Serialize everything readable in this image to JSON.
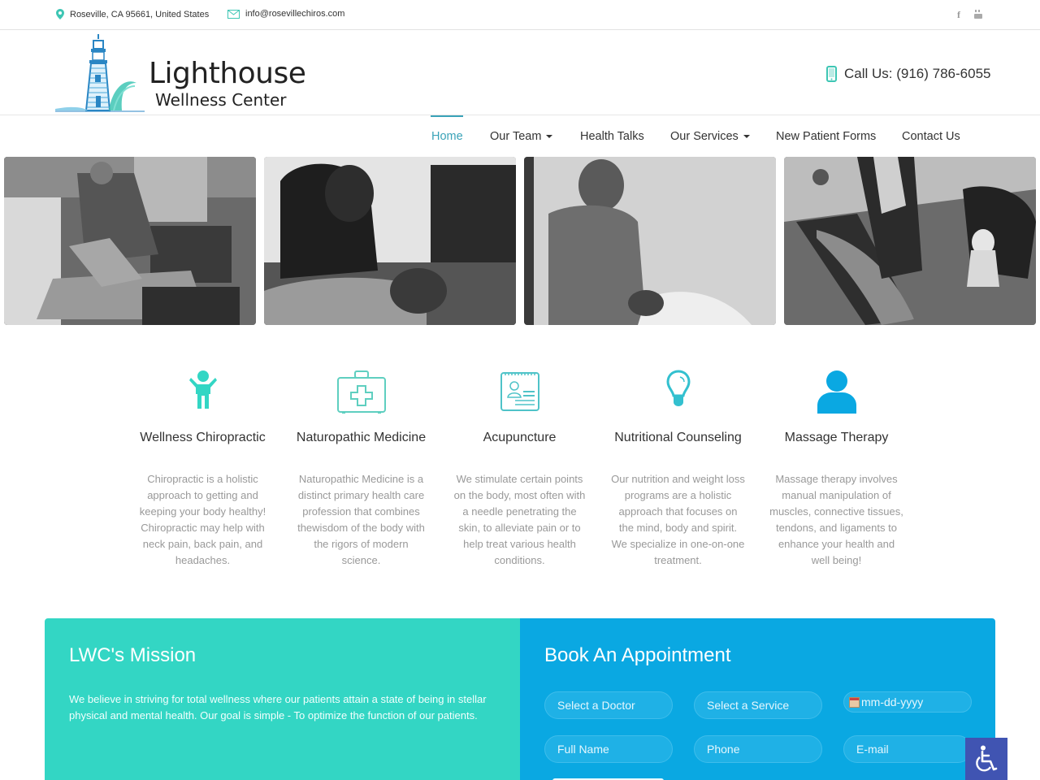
{
  "topbar": {
    "address": "Roseville, CA 95661, United States",
    "email": "info@rosevillechiros.com",
    "social": [
      {
        "name": "facebook",
        "glyph": "f"
      },
      {
        "name": "youtube",
        "glyph": "▣"
      }
    ]
  },
  "header": {
    "logo_title": "Lighthouse",
    "logo_subtitle": "Wellness Center",
    "call_label": "Call Us: (916) 786-6055"
  },
  "nav": {
    "items": [
      {
        "label": "Home",
        "active": true,
        "dropdown": false
      },
      {
        "label": "Our Team",
        "active": false,
        "dropdown": true
      },
      {
        "label": "Health Talks",
        "active": false,
        "dropdown": false
      },
      {
        "label": "Our Services",
        "active": false,
        "dropdown": true
      },
      {
        "label": "New Patient Forms",
        "active": false,
        "dropdown": false
      },
      {
        "label": "Contact Us",
        "active": false,
        "dropdown": false
      }
    ]
  },
  "photos": [
    {
      "alt": "Chiropractor adjusting patient's leg"
    },
    {
      "alt": "Practitioner pressing on patient's back"
    },
    {
      "alt": "Chiropractor adjusting patient's neck"
    },
    {
      "alt": "Practitioner adjusting patient while children watch"
    }
  ],
  "services": [
    {
      "icon": "child-icon",
      "title": "Wellness Chiropractic",
      "description": "Chiropractic is a holistic approach to getting and keeping your body healthy! Chiropractic may help with neck pain, back pain, and headaches."
    },
    {
      "icon": "medical-kit-icon",
      "title": "Naturopathic Medicine",
      "description": "Naturopathic Medicine is a distinct primary health care profession that combines thewisdom of the body with the rigors of modern science."
    },
    {
      "icon": "patient-chart-icon",
      "title": "Acupuncture",
      "description": "We stimulate certain points on the body, most often with a needle penetrating the skin, to alleviate pain or to help treat various health conditions."
    },
    {
      "icon": "lightbulb-icon",
      "title": "Nutritional Counseling",
      "description": "Our nutrition and weight loss programs are a holistic approach that focuses on the mind, body and spirit. We specialize in one-on-one treatment."
    },
    {
      "icon": "person-icon",
      "title": "Massage Therapy",
      "description": "Massage therapy involves manual manipulation of muscles, connective tissues, tendons, and ligaments to enhance your health and well being!"
    }
  ],
  "mission": {
    "title": "LWC's Mission",
    "text": "We believe in striving for total wellness where our patients attain a state of being in stellar physical and mental health. Our goal is simple - To optimize the function of our patients."
  },
  "booking": {
    "title": "Book An Appointment",
    "doctor_select": "Select a Doctor",
    "service_select": "Select a Service",
    "date_placeholder": "mm-dd-yyyy",
    "name_placeholder": "Full Name",
    "phone_placeholder": "Phone",
    "email_placeholder": "E-mail"
  },
  "colors": {
    "accent_teal": "#33d6c4",
    "accent_blue": "#0aa8e2",
    "nav_active": "#3aa3b8",
    "accessibility": "#4054b2"
  }
}
